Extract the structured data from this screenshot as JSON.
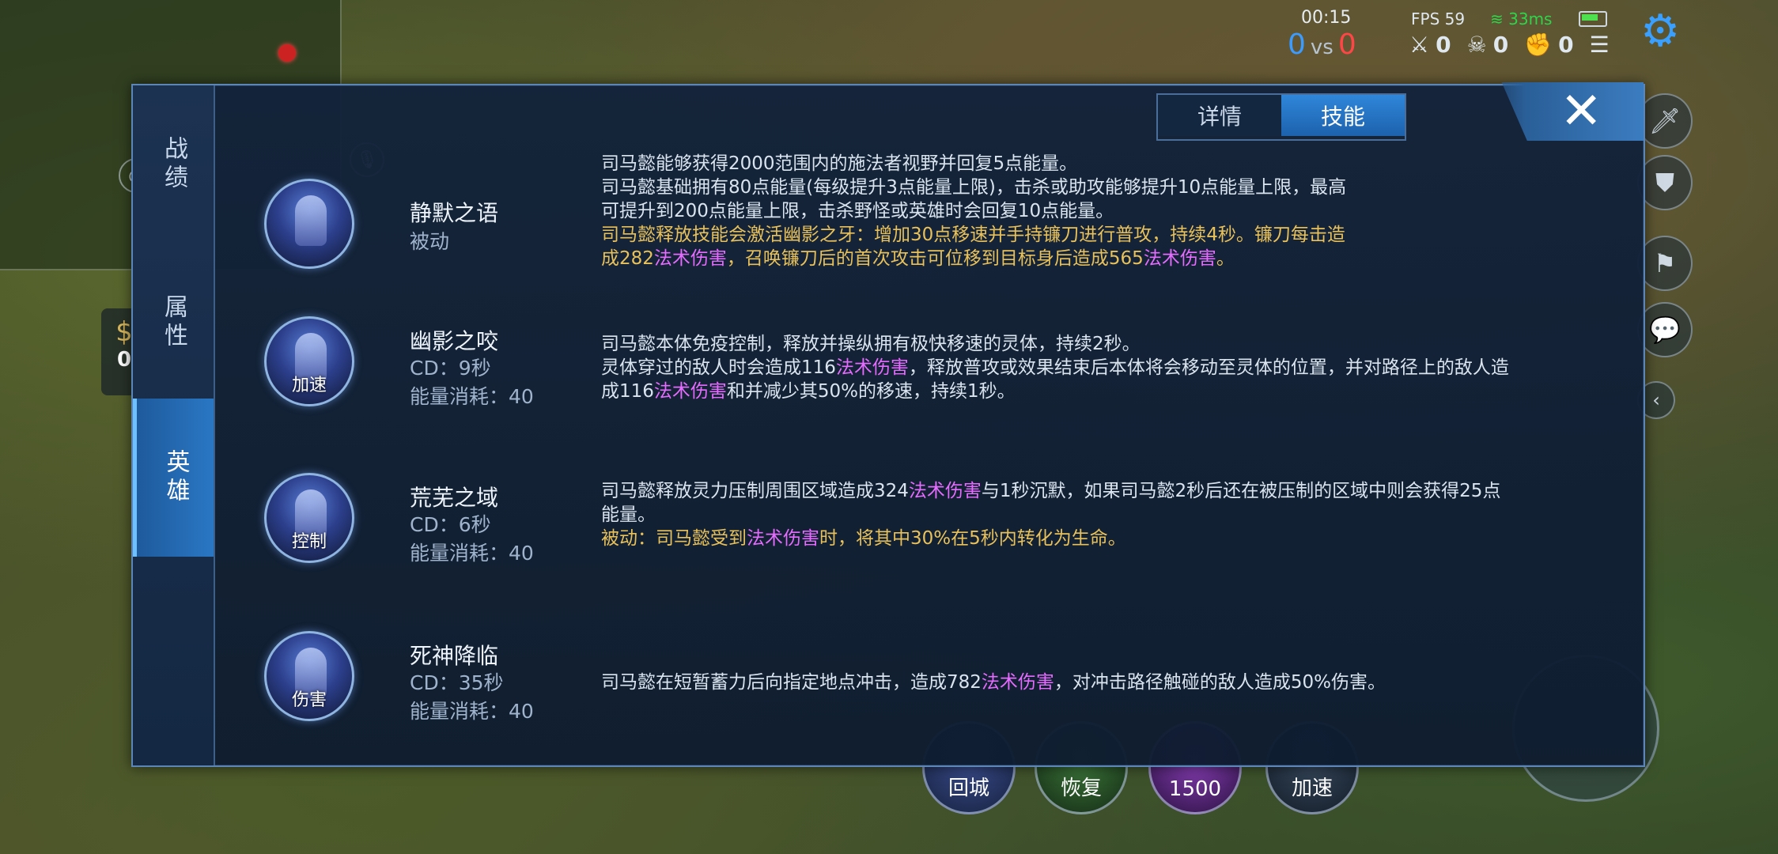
{
  "hud": {
    "timer": "00:15",
    "score_blue": "0",
    "score_vs": "vs",
    "score_red": "0",
    "fps": "FPS 59",
    "ping": "33ms",
    "kills": "0",
    "deaths": "0",
    "assists": "0",
    "gold": "0",
    "skill_buttons": {
      "recall": "回城",
      "heal": "恢复",
      "summoner_cost": "1500",
      "sprint": "加速"
    }
  },
  "panel": {
    "sidebar": [
      "战绩",
      "属性",
      "英雄"
    ],
    "tabs": [
      "详情",
      "技能"
    ],
    "active_tab": "技能",
    "close_label": "✕",
    "skills": [
      {
        "name": "静默之语",
        "meta1": "被动",
        "meta2": "",
        "icon_tag": "",
        "desc_lines": [
          {
            "parts": [
              {
                "t": "司马懿能够获得2000范围内的施法者视野并回复5点能量。",
                "c": ""
              }
            ]
          },
          {
            "parts": [
              {
                "t": "司马懿基础拥有80点能量(每级提升3点能量上限)，击杀或助攻能够提升10点能量上限，最高",
                "c": ""
              }
            ]
          },
          {
            "parts": [
              {
                "t": "可提升到200点能量上限，击杀野怪或英雄时会回复10点能量。",
                "c": ""
              }
            ]
          },
          {
            "parts": [
              {
                "t": "司马懿释放技能会激活幽影之牙：增加30点移速并手持镰刀进行普攻，持续4秒。镰刀每击造",
                "c": "y"
              }
            ]
          },
          {
            "parts": [
              {
                "t": "成282",
                "c": "y"
              },
              {
                "t": "法术伤害",
                "c": "m"
              },
              {
                "t": "，召唤镰刀后的首次攻击可位移到目标身后造成565",
                "c": "y"
              },
              {
                "t": "法术伤害",
                "c": "m"
              },
              {
                "t": "。",
                "c": "y"
              }
            ]
          }
        ]
      },
      {
        "name": "幽影之咬",
        "meta1": "CD：9秒",
        "meta2": "能量消耗：40",
        "icon_tag": "加速",
        "desc_lines": [
          {
            "parts": [
              {
                "t": "司马懿本体免疫控制，释放并操纵拥有极快移速的灵体，持续2秒。",
                "c": ""
              }
            ]
          },
          {
            "parts": [
              {
                "t": "灵体穿过的敌人时会造成116",
                "c": ""
              },
              {
                "t": "法术伤害",
                "c": "m"
              },
              {
                "t": "，释放普攻或效果结束后本体将会移动至灵体的位置，并对路径上的敌人造",
                "c": ""
              }
            ]
          },
          {
            "parts": [
              {
                "t": "成116",
                "c": ""
              },
              {
                "t": "法术伤害",
                "c": "m"
              },
              {
                "t": "和并减少其50%的移速，持续1秒。",
                "c": ""
              }
            ]
          }
        ]
      },
      {
        "name": "荒芜之域",
        "meta1": "CD：6秒",
        "meta2": "能量消耗：40",
        "icon_tag": "控制",
        "desc_lines": [
          {
            "parts": [
              {
                "t": "司马懿释放灵力压制周围区域造成324",
                "c": ""
              },
              {
                "t": "法术伤害",
                "c": "m"
              },
              {
                "t": "与1秒沉默，如果司马懿2秒后还在被压制的区域中则会获得25点",
                "c": ""
              }
            ]
          },
          {
            "parts": [
              {
                "t": "能量。",
                "c": ""
              }
            ]
          },
          {
            "parts": [
              {
                "t": "被动：司马懿受到",
                "c": "y"
              },
              {
                "t": "法术伤害",
                "c": "m"
              },
              {
                "t": "时，将其中30%在5秒内转化为生命。",
                "c": "y"
              }
            ]
          }
        ]
      },
      {
        "name": "死神降临",
        "meta1": "CD：35秒",
        "meta2": "能量消耗：40",
        "icon_tag": "伤害",
        "desc_lines": [
          {
            "parts": [
              {
                "t": "司马懿在短暂蓄力后向指定地点冲击，造成782",
                "c": ""
              },
              {
                "t": "法术伤害",
                "c": "m"
              },
              {
                "t": "，对冲击路径触碰的敌人造成50%伤害。",
                "c": ""
              }
            ]
          }
        ]
      }
    ]
  }
}
